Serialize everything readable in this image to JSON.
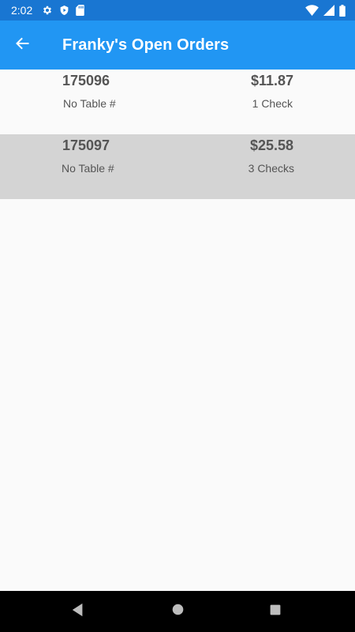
{
  "status_bar": {
    "time": "2:02",
    "left_icons": [
      "gear-icon",
      "shield-icon",
      "sd-card-icon"
    ],
    "right_icons": [
      "wifi-icon",
      "cell-signal-icon",
      "battery-icon"
    ]
  },
  "app_bar": {
    "title": "Franky's Open Orders",
    "back_icon": "arrow-back-icon"
  },
  "orders": [
    {
      "number": "175096",
      "amount": "$11.87",
      "table": "No Table #",
      "checks": "1 Check",
      "selected": false
    },
    {
      "number": "175097",
      "amount": "$25.58",
      "table": "No Table #",
      "checks": "3 Checks",
      "selected": true
    }
  ],
  "nav_bar": {
    "buttons": [
      "back-triangle-icon",
      "home-circle-icon",
      "recents-square-icon"
    ]
  },
  "colors": {
    "status_bar": "#1976d2",
    "app_bar": "#2196f3",
    "selected_row": "#d4d4d4",
    "background": "#fafafa"
  }
}
